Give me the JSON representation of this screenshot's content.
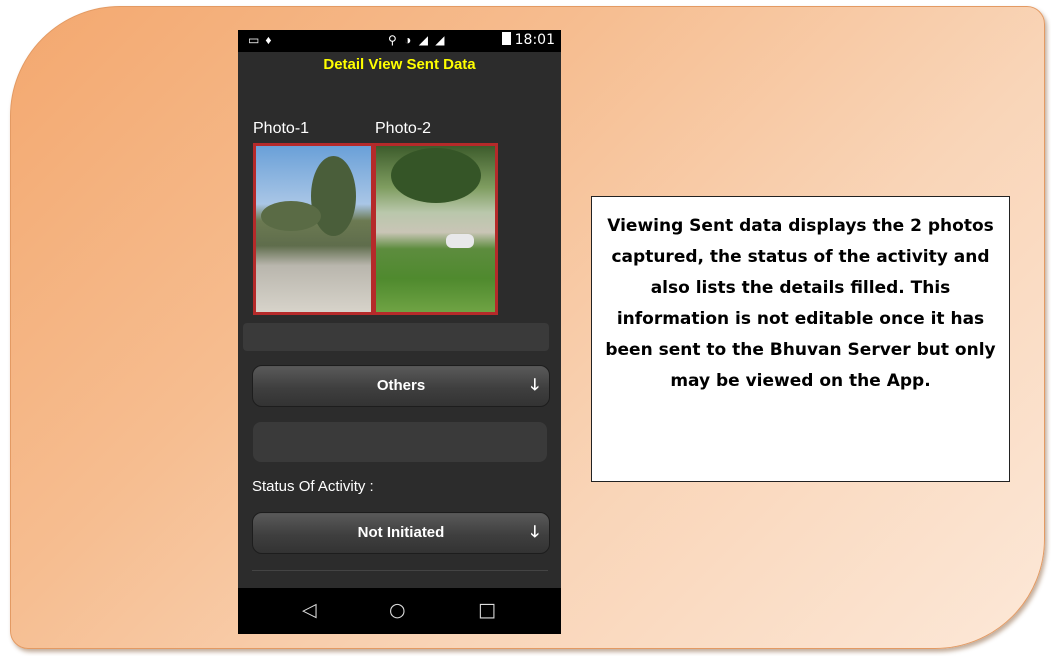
{
  "status_bar": {
    "time": "18:01"
  },
  "app": {
    "title": "Detail View Sent Data"
  },
  "photos": [
    {
      "label": "Photo-1"
    },
    {
      "label": "Photo-2"
    }
  ],
  "category_dropdown": {
    "selected": "Others"
  },
  "status_of_activity": {
    "label": "Status Of Activity :",
    "selected": "Not Initiated"
  },
  "nav": {
    "back": "◁",
    "home": "○",
    "recents": "□"
  },
  "caption": {
    "text": "Viewing Sent data displays the 2 photos captured, the status of the activity and also lists the details filled. This information is not editable once it has been sent to the Bhuvan Server but only may be viewed on the App."
  }
}
